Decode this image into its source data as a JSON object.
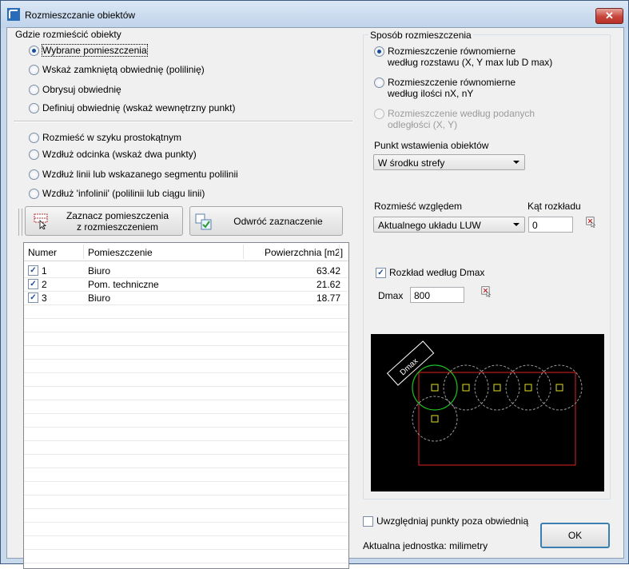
{
  "window": {
    "title": "Rozmieszczanie obiektów",
    "close_label": "✕"
  },
  "left": {
    "where_label": "Gdzie rozmieścić obiekty",
    "where_options": [
      "Wybrane pomieszczenia",
      "Wskaż zamkniętą obwiednię (polilinię)",
      "Obrysuj obwiednię",
      "Definiuj obwiednię (wskaż wewnętrzny punkt)"
    ],
    "where_selected": 0,
    "layout_options": [
      "Rozmieść w szyku prostokątnym",
      "Wzdłuż odcinka (wskaż dwa punkty)",
      "Wzdłuż linii lub wskazanego segmentu polilinii",
      "Wzdłuż 'infolinii' (polilinii lub ciągu linii)"
    ],
    "select_rooms_button": "Zaznacz pomieszczenia\nz rozmieszczeniem",
    "invert_selection_button": "Odwróć zaznaczenie",
    "table": {
      "columns": [
        "Numer",
        "Pomieszczenie",
        "Powierzchnia [m2]"
      ],
      "rows": [
        {
          "checked": true,
          "number": "1",
          "room": "Biuro",
          "area": "63.42"
        },
        {
          "checked": true,
          "number": "2",
          "room": "Pom. techniczne",
          "area": "21.62"
        },
        {
          "checked": true,
          "number": "3",
          "room": "Biuro",
          "area": "18.77"
        }
      ]
    }
  },
  "right": {
    "method_label": "Sposób rozmieszczenia",
    "method_options": [
      {
        "line1": "Rozmieszczenie równomierne",
        "line2": "według rozstawu (X, Y max lub D max)",
        "enabled": true
      },
      {
        "line1": "Rozmieszczenie równomierne",
        "line2": "według ilości nX, nY",
        "enabled": true
      },
      {
        "line1": "Rozmieszczenie według podanych",
        "line2": "odległości (X, Y)",
        "enabled": false
      }
    ],
    "method_selected": 0,
    "insert_point_label": "Punkt wstawienia obiektów",
    "insert_point_value": "W środku strefy",
    "place_relative_label": "Rozmieść względem",
    "place_relative_value": "Aktualnego układu LUW",
    "angle_label": "Kąt rozkładu",
    "angle_value": "0",
    "dmax_checkbox_label": "Rozkład według Dmax",
    "dmax_checked": true,
    "dmax_label": "Dmax",
    "dmax_value": "800",
    "preview_label": "Dmax",
    "include_outside_label": "Uwzględniaj punkty poza obwiednią",
    "include_outside_checked": false,
    "ok_button": "OK",
    "unit_text": "Aktualna jednostka: milimetry"
  },
  "colors": {
    "title_bar": "#c9d9ec",
    "close_button": "#c7443a",
    "preview_bg": "#000000",
    "preview_rect": "#e02020",
    "preview_circle_active": "#20c020",
    "preview_marker": "#e0e020"
  },
  "icons": {
    "app": "app-logo-icon",
    "select_rooms": "table-selection-icon",
    "invert": "invert-selection-icon",
    "pick": "pick-point-icon"
  }
}
